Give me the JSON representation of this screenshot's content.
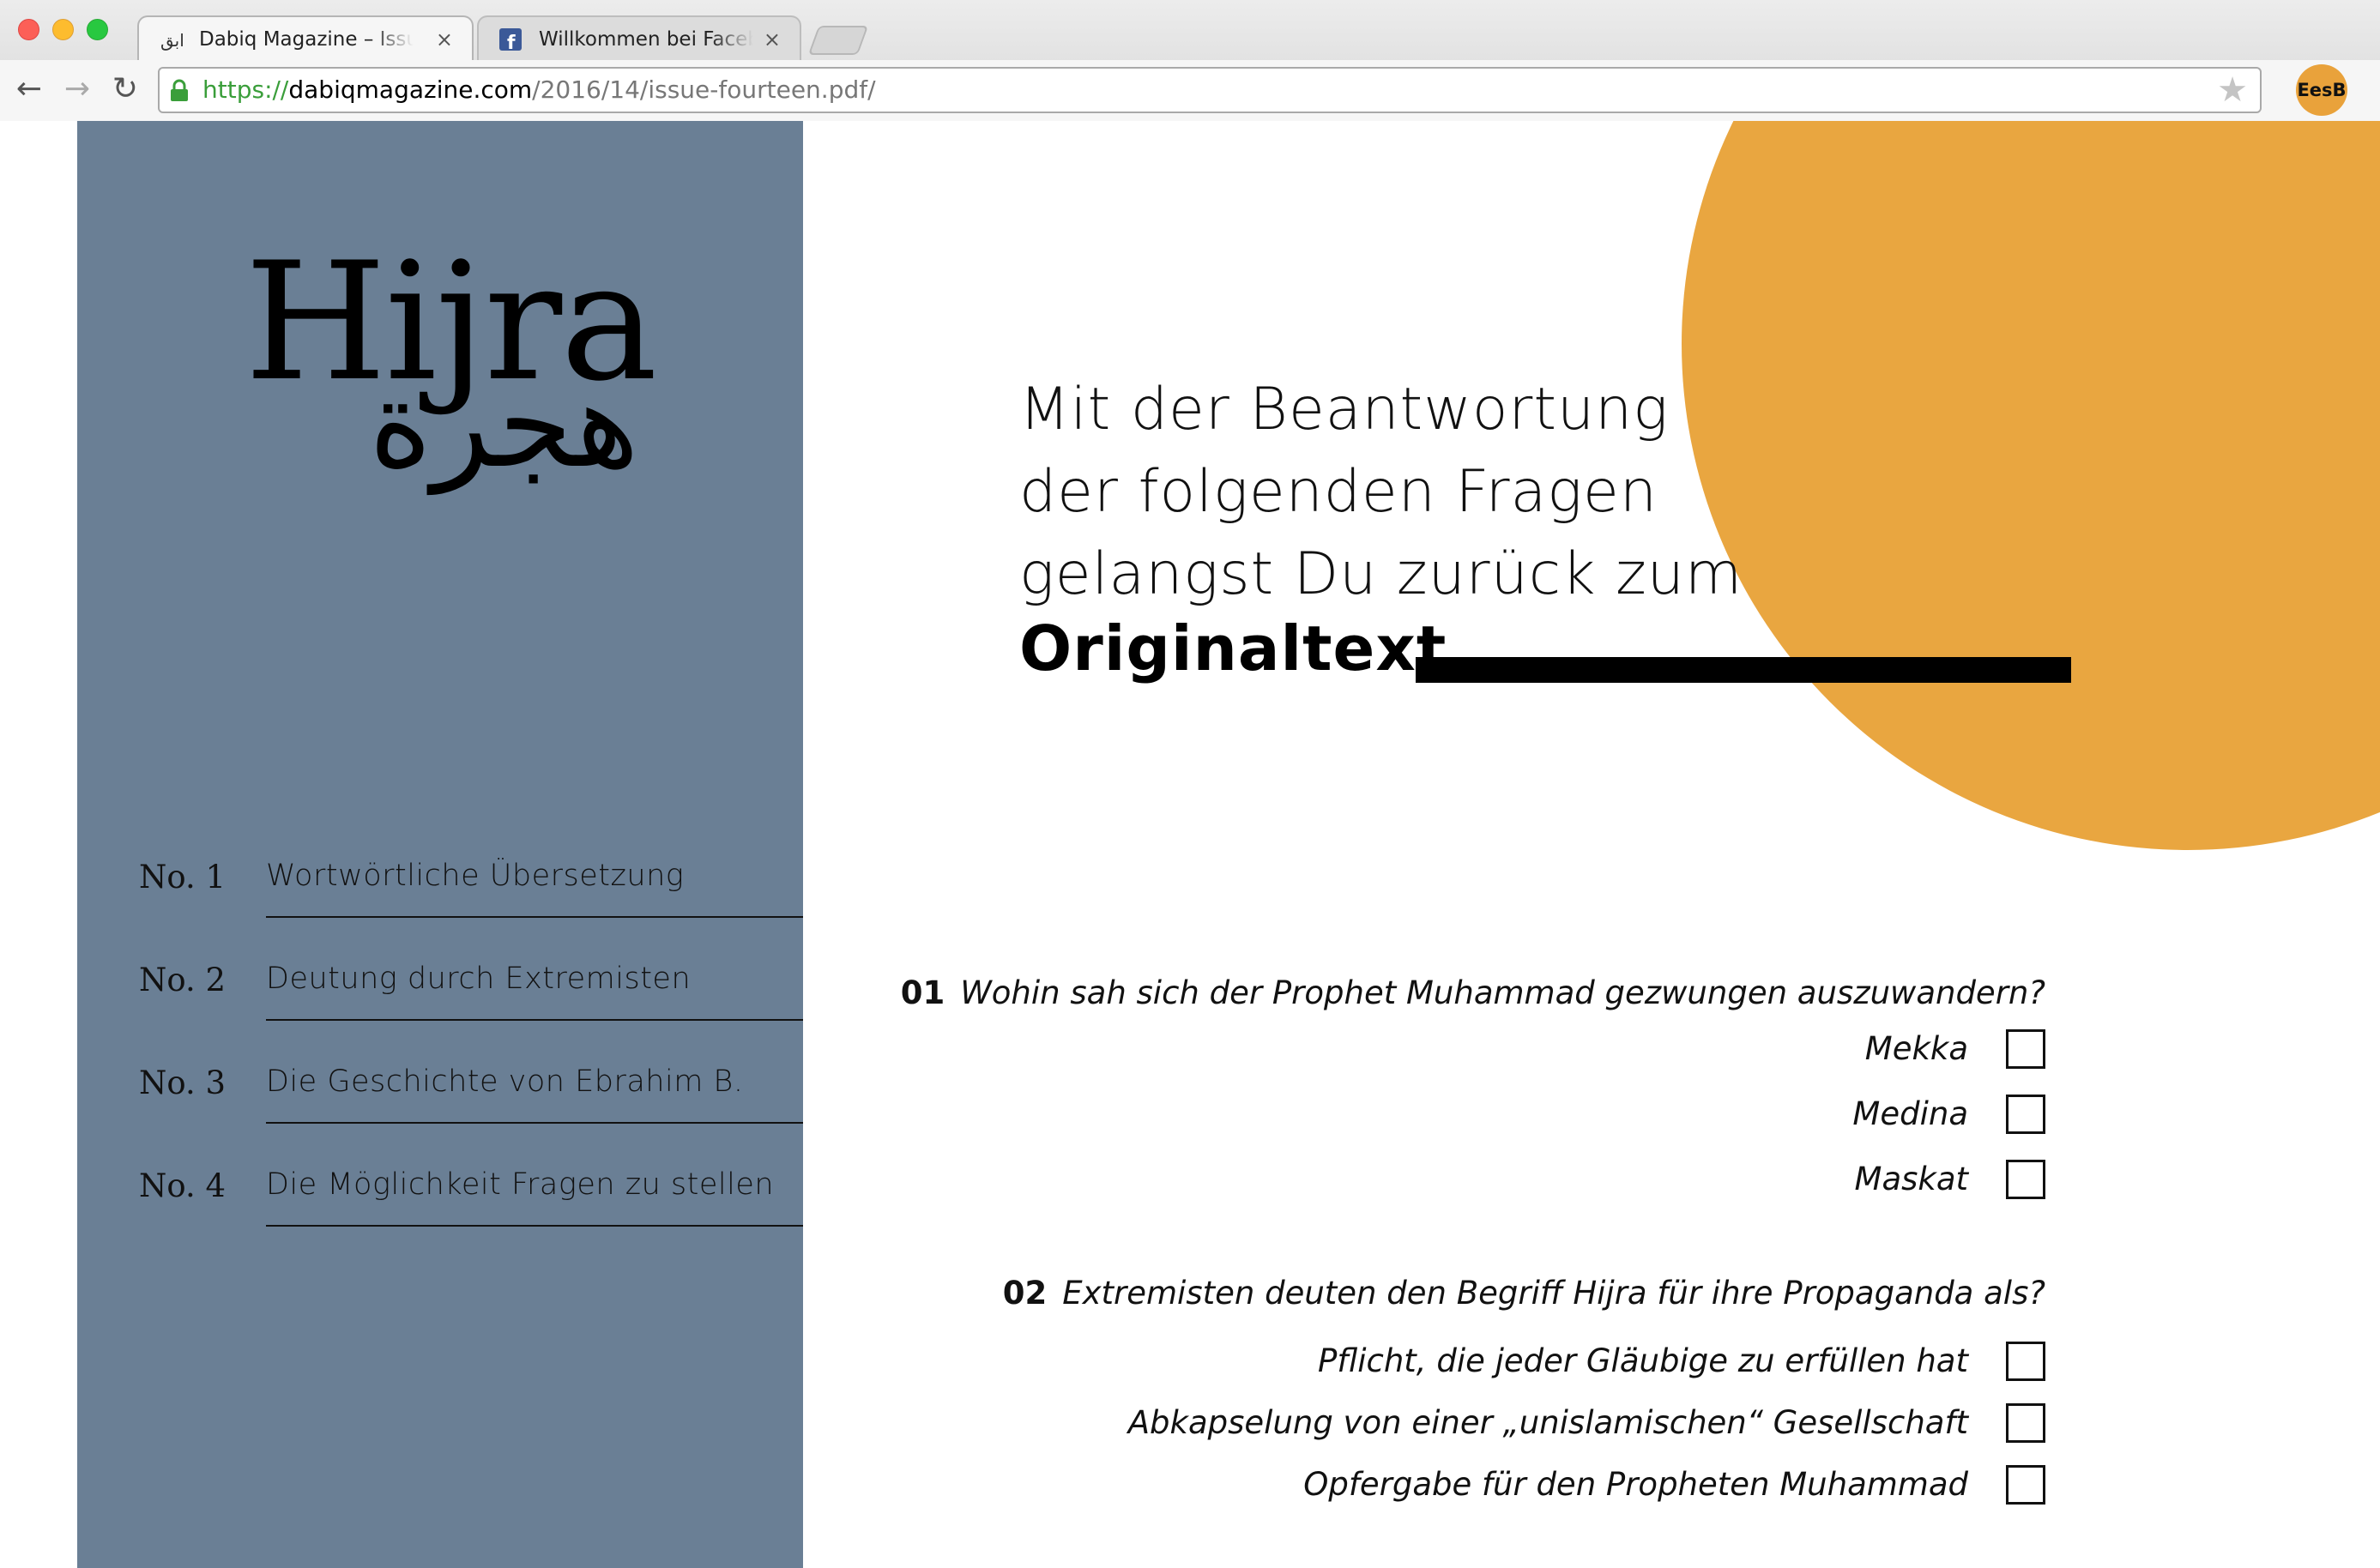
{
  "browser": {
    "tabs": [
      {
        "title": "Dabiq Magazine – Issue F",
        "favicon": "dabiq-favicon",
        "active": true
      },
      {
        "title": "Willkommen bei Facebook",
        "favicon": "facebook-icon",
        "active": false
      }
    ],
    "close_glyph": "×",
    "url": {
      "scheme": "https://",
      "host": "dabiqmagazine.com",
      "path": "/2016/14/issue-fourteen.pdf/"
    },
    "profile_label": "EesB",
    "icons": {
      "back": "←",
      "forward": "→",
      "reload": "↻",
      "star": "★"
    }
  },
  "sidebar": {
    "logo_latin": "Hijra",
    "logo_arabic": "هجرة",
    "items": [
      {
        "num": "No. 1",
        "label": "Wortwörtliche Übersetzung"
      },
      {
        "num": "No. 2",
        "label": "Deutung durch Extremisten"
      },
      {
        "num": "No. 3",
        "label": "Die Geschichte von Ebrahim B."
      },
      {
        "num": "No. 4",
        "label": "Die Möglichkeit Fragen zu stellen"
      }
    ]
  },
  "intro": {
    "lines": [
      "Mit der Beantwortung",
      "der folgenden Fragen",
      "gelangst Du zurück zum"
    ],
    "strong": "Originaltext"
  },
  "questions": [
    {
      "num": "01",
      "text": "Wohin sah sich der Prophet Muhammad gezwungen auszuwandern?",
      "options": [
        "Mekka",
        "Medina",
        "Maskat"
      ]
    },
    {
      "num": "02",
      "text": "Extremisten deuten den Begriff Hijra für ihre Propaganda als?",
      "options": [
        "Pflicht, die jeder Gläubige zu erfüllen hat",
        "Abkapselung von einer „unislamischen“ Gesellschaft",
        "Opfergabe für den Propheten Muhammad"
      ]
    }
  ],
  "colors": {
    "sidebar": "#6a7f95",
    "circle": "#e9a640",
    "profile": "#e9a23b"
  }
}
